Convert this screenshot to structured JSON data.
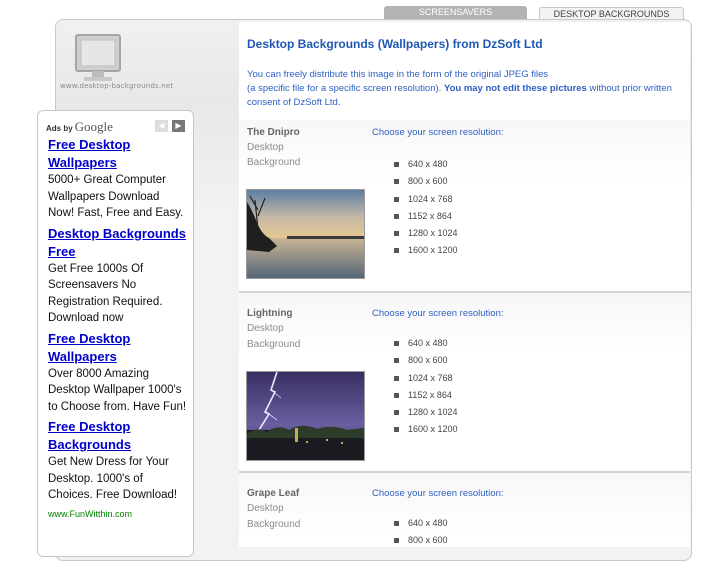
{
  "tabs": [
    {
      "label": "SCREENSAVERS",
      "active": false
    },
    {
      "label": "DESKTOP BACKGROUNDS",
      "active": true
    }
  ],
  "logo": {
    "text": "www.desktop-backgrounds.net",
    "icon": "monitor-icon"
  },
  "ads": {
    "adsby_label": "Ads by",
    "google_label": "Google",
    "prev_icon": "chevron-left-icon",
    "next_icon": "chevron-right-icon",
    "items": [
      {
        "title": "Free Desktop Wallpapers",
        "desc": "5000+ Great Computer Wallpapers Download Now! Fast, Free and Easy."
      },
      {
        "title": "Desktop Backgrounds Free",
        "desc": "Get Free 1000s Of Screensavers No Registration Required. Download now"
      },
      {
        "title": "Free Desktop Wallpapers",
        "desc": "Over 8000 Amazing Desktop Wallpaper 1000's to Choose from. Have Fun!"
      },
      {
        "title": "Free Desktop Backgrounds",
        "desc": "Get New Dress for Your Desktop. 1000's of Choices. Free Download!",
        "url": "www.FunWitthin.com"
      }
    ]
  },
  "main": {
    "title": "Desktop Backgrounds (Wallpapers) from DzSoft Ltd",
    "intro_line1": "You can freely distribute this image in the form of the original JPEG files",
    "intro_line2a": "(a specific file for a specific screen resolution). ",
    "intro_bold": "You may not edit these pictures",
    "intro_line2b": " without prior written consent of DzSoft Ltd."
  },
  "entries": [
    {
      "name": "The Dnipro",
      "sub1": "Desktop",
      "sub2": "Background",
      "choose": "Choose your screen resolution:",
      "resolutions": [
        "640 x 480",
        "800 x 600",
        "1024 x 768",
        "1152 x 864",
        "1280 x 1024",
        "1600 x 1200"
      ]
    },
    {
      "name": "Lightning",
      "sub1": "Desktop",
      "sub2": "Background",
      "choose": "Choose your screen resolution:",
      "resolutions": [
        "640 x 480",
        "800 x 600",
        "1024 x 768",
        "1152 x 864",
        "1280 x 1024",
        "1600 x 1200"
      ]
    },
    {
      "name": "Grape Leaf",
      "sub1": "Desktop",
      "sub2": "Background",
      "choose": "Choose your screen resolution:",
      "resolutions": [
        "640 x 480",
        "800 x 600"
      ]
    }
  ]
}
